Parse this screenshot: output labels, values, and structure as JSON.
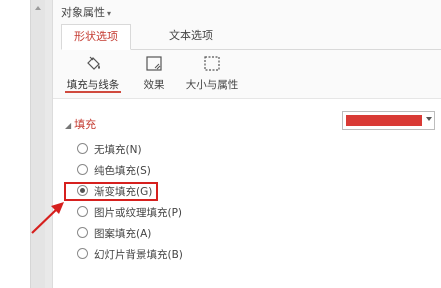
{
  "panel": {
    "title": "对象属性",
    "title_caret": "▾"
  },
  "tabs": [
    {
      "label": "形状选项",
      "active": true
    },
    {
      "label": "文本选项",
      "active": false
    }
  ],
  "subtabs": [
    {
      "label": "填充与线条",
      "icon": "paint-bucket-icon",
      "active": true
    },
    {
      "label": "效果",
      "icon": "effects-icon",
      "active": false
    },
    {
      "label": "大小与属性",
      "icon": "size-properties-icon",
      "active": false
    }
  ],
  "fill": {
    "section_label": "填充",
    "collapse_glyph": "◢",
    "color_value": "#d93a35",
    "options": [
      {
        "label": "无填充(N)",
        "checked": false
      },
      {
        "label": "纯色填充(S)",
        "checked": false
      },
      {
        "label": "渐变填充(G)",
        "checked": true
      },
      {
        "label": "图片或纹理填充(P)",
        "checked": false
      },
      {
        "label": "图案填充(A)",
        "checked": false
      },
      {
        "label": "幻灯片背景填充(B)",
        "checked": false
      }
    ]
  },
  "annotation": {
    "color": "#d6201e"
  }
}
